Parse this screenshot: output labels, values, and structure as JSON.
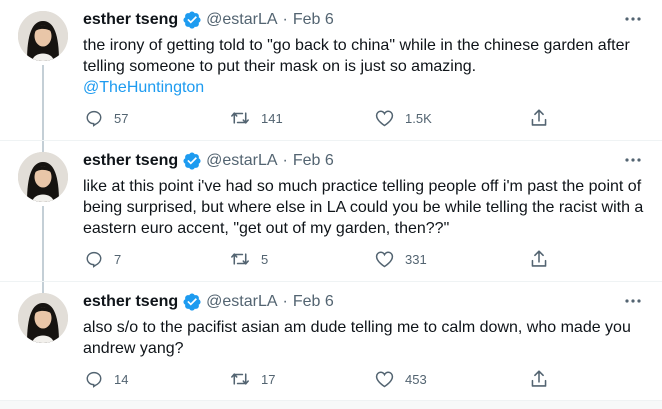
{
  "colors": {
    "accent": "#1d9bf0",
    "secondary_text": "#536471",
    "thread_line": "#c4cfd6"
  },
  "tweets": [
    {
      "name": "esther tseng",
      "handle": "@estarLA",
      "separator": "·",
      "date": "Feb 6",
      "text": "the irony of getting told to \"go back to china\" while in the chinese garden after telling someone to put their mask on is just so amazing.",
      "mention": "@TheHuntington",
      "replies": "57",
      "retweets": "141",
      "likes": "1.5K",
      "icons": [
        "reply-icon",
        "retweet-icon",
        "like-icon",
        "share-icon",
        "more-icon",
        "verified-icon"
      ]
    },
    {
      "name": "esther tseng",
      "handle": "@estarLA",
      "separator": "·",
      "date": "Feb 6",
      "text": "like at this point i've had so much practice telling people off i'm past the point of being surprised, but where else in LA could you be while telling the racist with a eastern euro accent, \"get out of my garden, then??\"",
      "replies": "7",
      "retweets": "5",
      "likes": "331"
    },
    {
      "name": "esther tseng",
      "handle": "@estarLA",
      "separator": "·",
      "date": "Feb 6",
      "text": "also s/o to the pacifist asian am dude telling me to calm down, who made you andrew yang?",
      "replies": "14",
      "retweets": "17",
      "likes": "453"
    }
  ]
}
